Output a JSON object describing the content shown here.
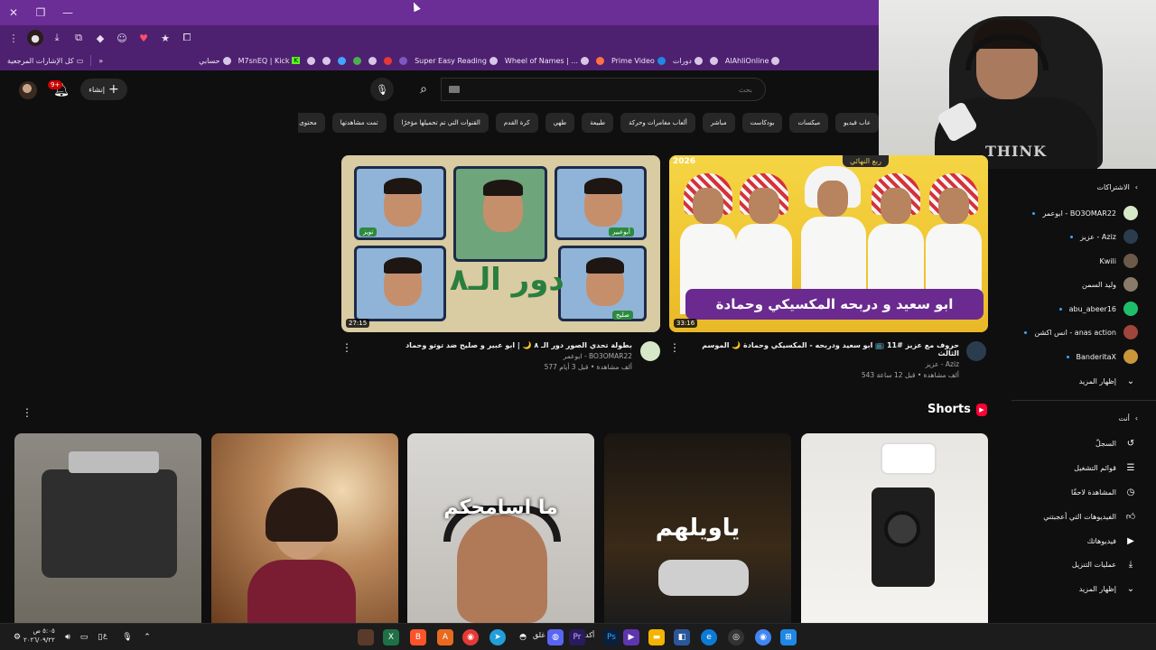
{
  "browser": {
    "bookmarks": [
      {
        "label": "كل الإشارات المرجعية"
      },
      {
        "label": "حسابي"
      },
      {
        "label": "M7snEQ | Kick"
      },
      {
        "label": "Super Easy Reading"
      },
      {
        "label": "Wheel of Names | ..."
      },
      {
        "label": "Prime Video"
      },
      {
        "label": "دورات"
      },
      {
        "label": "AlAhliOnline"
      }
    ],
    "colors": {
      "titlebar": "#6b2d96",
      "toolbar": "#4e2170"
    }
  },
  "header": {
    "create_label": "إنشاء",
    "notif_badge": "9+",
    "search_placeholder": "بحث"
  },
  "chips": [
    "عاب فيديو",
    "ميكسات",
    "بودكاست",
    "مباشر",
    "ألعاب مغامرات وحركة",
    "طبيعة",
    "طهي",
    "كرة القدم",
    "القنوات التي تم تحميلها مؤخرًا",
    "تمت مشاهدتها",
    "محتوى جديد لك"
  ],
  "videos": [
    {
      "title": "حروف مع عزيز #11 📺 ابو سعيد ودربحه - المكسيكي وحمادة 🌙 الموسم الثالث",
      "channel": "عزيز - Aziz",
      "stats": "543 ألف مشاهدة • قبل 12 ساعة",
      "duration": "33:16",
      "thumb_banner": "ابو سعيد و دربحه المكسيكي وحمادة",
      "thumb_top": "ربع النهائي",
      "thumb_year": "2026"
    },
    {
      "title": "بطولة تحدي الصور دور الـ ٨ 🌙 | ابو عبير و صليح ضد توتو وحماد",
      "channel": "ابوعمر - BO3OMAR22",
      "stats": "577 ألف مشاهدة • قبل 3 أيام",
      "duration": "27:15",
      "thumb_title": "دور الـ٨",
      "tags": [
        "تويز",
        "أبوعبير",
        "صليح"
      ]
    }
  ],
  "shorts": {
    "heading": "Shorts",
    "items": [
      {
        "text": ""
      },
      {
        "text": ""
      },
      {
        "text": "ما اسامحكم"
      },
      {
        "text": "ياويلهم"
      },
      {
        "text": ""
      }
    ]
  },
  "sidebar": {
    "subscriptions_heading": "الاشتراكات",
    "subscriptions": [
      {
        "label": "ابوعمر - BO3OMAR22",
        "dot": true
      },
      {
        "label": "عزيز - Aziz",
        "dot": true
      },
      {
        "label": "Kwili",
        "dot": false
      },
      {
        "label": "وليد السمن",
        "dot": false
      },
      {
        "label": "abu_abeer16",
        "dot": true
      },
      {
        "label": "انس اكشن - anas action",
        "dot": true
      },
      {
        "label": "BanderitaX",
        "dot": true
      }
    ],
    "show_more_1": "إظهار المزيد",
    "you_heading": "أنت",
    "you_items": [
      {
        "label": "السجلّ",
        "icon": "history-icon"
      },
      {
        "label": "قوائم التشغيل",
        "icon": "playlist-icon"
      },
      {
        "label": "المشاهدة لاحقًا",
        "icon": "clock-icon"
      },
      {
        "label": "الفيديوهات التي أعجبتني",
        "icon": "thumbs-up-icon"
      },
      {
        "label": "فيديوهاتك",
        "icon": "play-icon"
      },
      {
        "label": "عمليات التنزيل",
        "icon": "download-icon"
      }
    ],
    "show_more_2": "إظهار المزيد"
  },
  "taskbar": {
    "clock_time": "٥:٠٥ ص",
    "clock_date": "٢٠٢٦/٠٩/٢٢",
    "lang": "ع",
    "pinned": [
      "kick-bar",
      "غلق",
      "Pr",
      "Ps",
      "أكد"
    ]
  }
}
